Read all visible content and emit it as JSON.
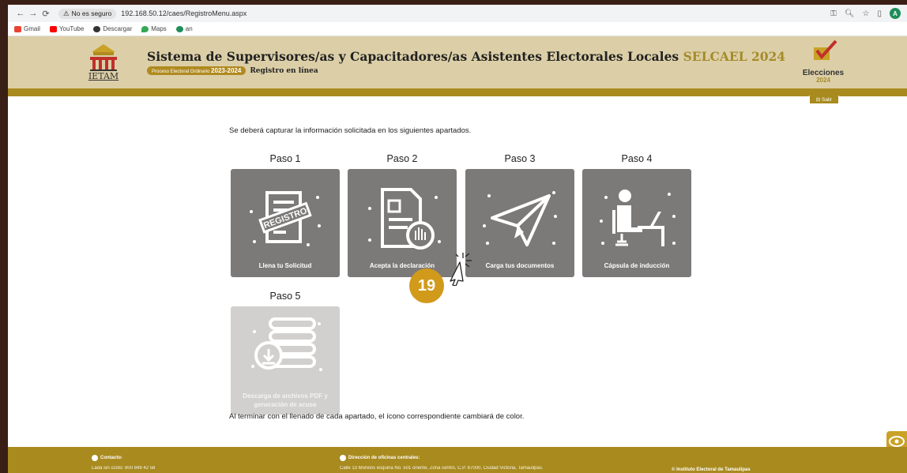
{
  "browser": {
    "security_label": "No es seguro",
    "url": "192.168.50.12/caes/RegistroMenu.aspx",
    "bookmarks": [
      {
        "label": "Gmail",
        "color": "#ea4335"
      },
      {
        "label": "YouTube",
        "color": "#ff0000"
      },
      {
        "label": "Descargar",
        "color": "#333333"
      },
      {
        "label": "Maps",
        "color": "#34a853"
      },
      {
        "label": "an",
        "color": "#1e8e5a"
      }
    ],
    "profile_initial": "A"
  },
  "header": {
    "title": "Sistema de Supervisores/as y Capacitadores/as Asistentes Electorales Locales",
    "title_accent": "SELCAEL 2024",
    "process_chip": "Proceso Electoral Ordinario",
    "process_years": "2023-2024",
    "subtitle": "Registro en línea",
    "logo_left_text": "IETAM",
    "logo_right_text": "Elecciones",
    "logo_right_year": "2024",
    "salir": "Salir"
  },
  "main": {
    "instruction": "Se deberá capturar la información solicitada en los siguientes apartados.",
    "steps": [
      {
        "label": "Paso 1",
        "card_text": "Llena tu Solicitud",
        "icon": "registro-document-icon",
        "enabled": true
      },
      {
        "label": "Paso 2",
        "card_text": "Acepta la declaración",
        "icon": "document-hand-icon",
        "enabled": true
      },
      {
        "label": "Paso 3",
        "card_text": "Carga tus documentos",
        "icon": "paper-plane-icon",
        "enabled": true
      },
      {
        "label": "Paso 4",
        "card_text": "Cápsula de inducción",
        "icon": "person-desk-icon",
        "enabled": true
      },
      {
        "label": "Paso 5",
        "card_text": "Descarga de archivos PDF y generación de acuse",
        "icon": "database-download-icon",
        "enabled": false
      }
    ],
    "bottom_note": "Al terminar con el llenado de cada apartado, el ícono correspondiente cambiará de color.",
    "step_badge": "19"
  },
  "footer": {
    "contact_heading": "Contacto:",
    "contact_text": "Lada sin costo: 800 849 42 58",
    "address_heading": "Dirección de oficinas centrales:",
    "address_text": "Calle 13 Morelos esquina No. 501 oriente, Zona centro, C.P. 87000, Ciudad Victoria, Tamaulipas.",
    "copyright": "© Instituto Electoral de Tamaulipas"
  },
  "colors": {
    "header_bg": "#dccfa7",
    "gold": "#a88a1e",
    "card": "#7c7a79",
    "card_disabled": "#d2d0cf",
    "badge": "#d19a1b"
  }
}
